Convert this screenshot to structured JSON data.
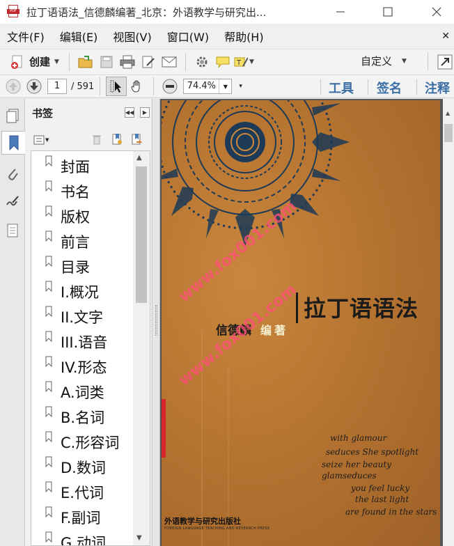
{
  "window": {
    "title": "拉丁语语法_信德麟编著_北京：外语教学与研究出...",
    "app_icon_text": "PDF"
  },
  "menu": [
    "文件(F)",
    "编辑(E)",
    "视图(V)",
    "窗口(W)",
    "帮助(H)"
  ],
  "toolbar": {
    "create_label": "创建",
    "customize_label": "自定义"
  },
  "navigation": {
    "current_page": "1",
    "total_pages": "/ 591",
    "zoom": "74.4%"
  },
  "panels": {
    "tools": "工具",
    "sign": "签名",
    "comment": "注释"
  },
  "bookmarks": {
    "title": "书签",
    "items": [
      "封面",
      "书名",
      "版权",
      "前言",
      "目录",
      "I.概况",
      "II.文字",
      "III.语音",
      "IV.形态",
      "A.词类",
      "B.名词",
      "C.形容词",
      "D.数词",
      "E.代词",
      "F.副词",
      "G.动词"
    ]
  },
  "document": {
    "cover_title": "拉丁语语法",
    "author": "信德麟",
    "role": "编著",
    "publisher": "外语教学与研究出版社",
    "publisher_en": "FOREIGN LANGUAGE TEACHING AND RESEARCH PRESS",
    "watermark": "www.fox001.com",
    "script_lines": [
      "with glamour",
      "seduces  She spotlight",
      "seize her beauty",
      "glamseduces",
      "you feel lucky",
      "the last light",
      "are found in the stars"
    ]
  },
  "colors": {
    "accent_link": "#3a6ea5",
    "cover_base": "#b67431",
    "watermark": "#ff5078"
  }
}
